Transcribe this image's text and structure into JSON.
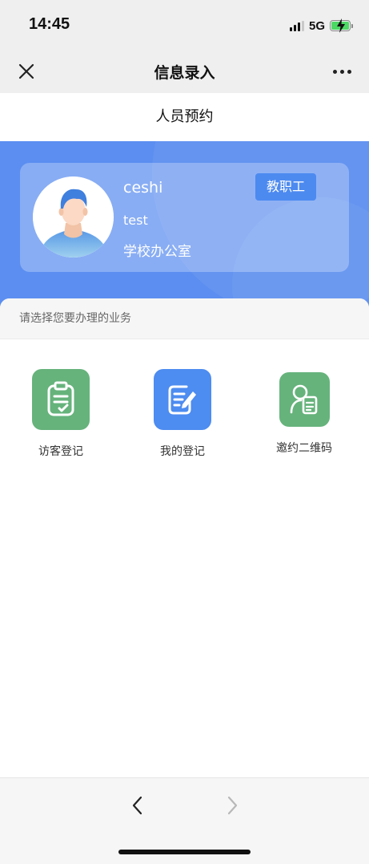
{
  "status_bar": {
    "time": "14:45",
    "network": "5G",
    "battery_state": "charging"
  },
  "nav": {
    "title": "信息录入",
    "close_icon": "close-icon",
    "more_icon": "more-icon"
  },
  "page": {
    "title": "人员预约"
  },
  "profile": {
    "name": "ceshi",
    "account": "test",
    "department": "学校办公室",
    "role": "教职工"
  },
  "business": {
    "prompt": "请选择您要办理的业务",
    "items": [
      {
        "label": "访客登记",
        "icon": "clipboard-check-icon"
      },
      {
        "label": "我的登记",
        "icon": "edit-document-icon"
      },
      {
        "label": "邀约二维码",
        "icon": "user-document-icon"
      }
    ]
  },
  "toolbar": {
    "back_icon": "chevron-left-icon",
    "forward_icon": "chevron-right-icon"
  },
  "colors": {
    "hero_blue": "#5b8ef0",
    "badge_blue": "#4c8af0",
    "tile_green": "#66b37c",
    "tile_blue": "#4d8cf0"
  }
}
